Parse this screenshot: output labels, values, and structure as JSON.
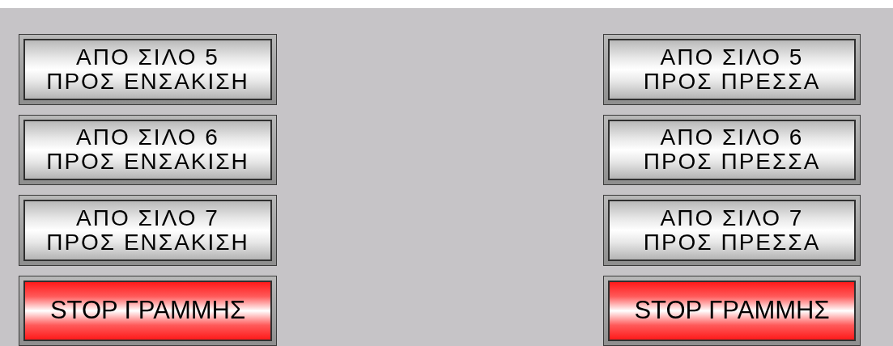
{
  "columns": [
    {
      "buttons": [
        {
          "kind": "route",
          "label": "ΑΠΟ ΣΙΛΟ 5\nΠΡΟΣ ΕΝΣΑΚΙΣΗ"
        },
        {
          "kind": "route",
          "label": "ΑΠΟ ΣΙΛΟ 6\nΠΡΟΣ ΕΝΣΑΚΙΣΗ"
        },
        {
          "kind": "route",
          "label": "ΑΠΟ ΣΙΛΟ 7\nΠΡΟΣ ΕΝΣΑΚΙΣΗ"
        },
        {
          "kind": "stop",
          "label": "STOP ΓΡΑΜΜΗΣ"
        }
      ]
    },
    {
      "buttons": [
        {
          "kind": "route",
          "label": "ΑΠΟ ΣΙΛΟ 5\nΠΡΟΣ ΠΡΕΣΣΑ"
        },
        {
          "kind": "route",
          "label": "ΑΠΟ ΣΙΛΟ 6\nΠΡΟΣ ΠΡΕΣΣΑ"
        },
        {
          "kind": "route",
          "label": "ΑΠΟ ΣΙΛΟ 7\nΠΡΟΣ ΠΡΕΣΣΑ"
        },
        {
          "kind": "stop",
          "label": "STOP ΓΡΑΜΜΗΣ"
        }
      ]
    }
  ]
}
